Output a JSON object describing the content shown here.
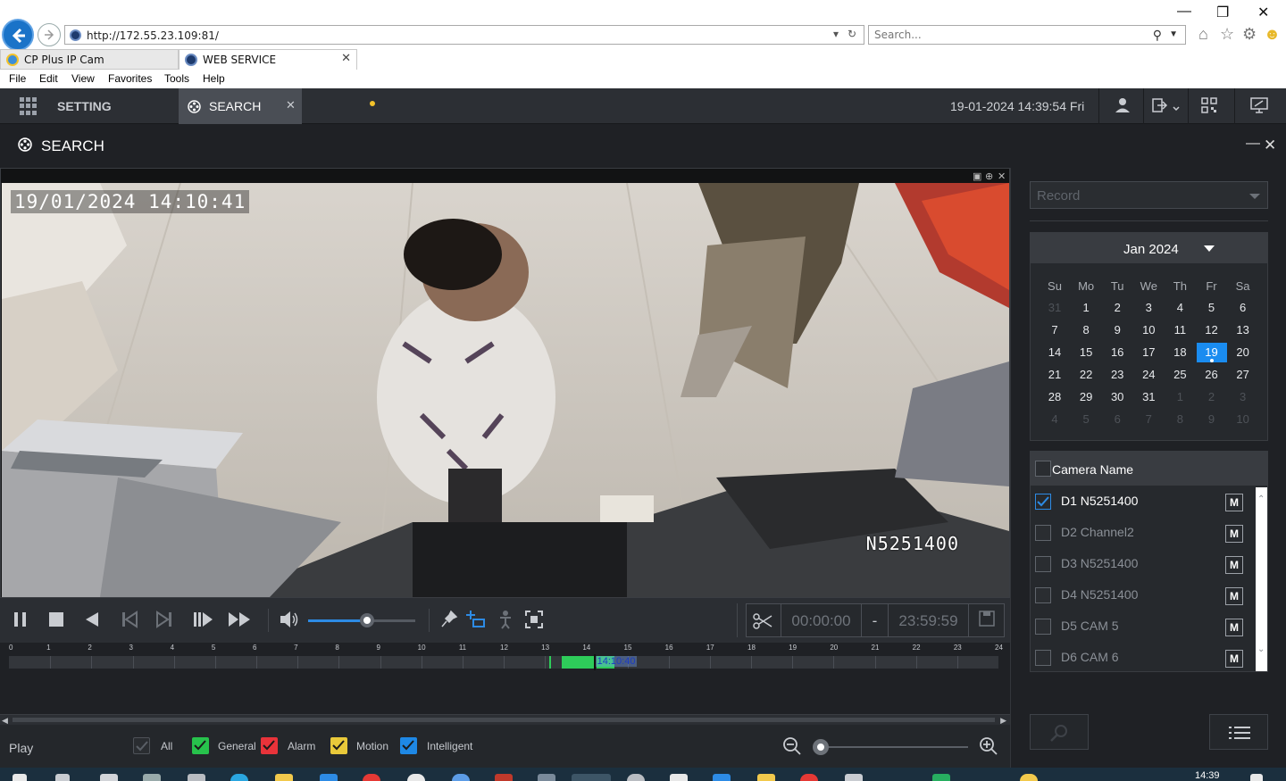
{
  "browser": {
    "url": "http://172.55.23.109:81/",
    "search_placeholder": "Search...",
    "tabs": [
      {
        "label": "CP Plus IP Cam",
        "active": false
      },
      {
        "label": "WEB SERVICE",
        "active": true
      }
    ],
    "menu": [
      "File",
      "Edit",
      "View",
      "Favorites",
      "Tools",
      "Help"
    ]
  },
  "app": {
    "nav_tabs": [
      "SETTING",
      "SEARCH"
    ],
    "clock": "19-01-2024 14:39:54 Fri",
    "page_title": "SEARCH"
  },
  "video": {
    "osd_timestamp": "19/01/2024 14:10:41",
    "osd_camera": "N5251400"
  },
  "controls": {
    "volume_level": 0.55,
    "clip_start": "00:00:00",
    "clip_sep": "-",
    "clip_end": "23:59:59"
  },
  "timeline": {
    "hours": [
      "0",
      "1",
      "2",
      "3",
      "4",
      "5",
      "6",
      "7",
      "8",
      "9",
      "10",
      "11",
      "12",
      "13",
      "14",
      "15",
      "16",
      "17",
      "18",
      "19",
      "20",
      "21",
      "22",
      "23",
      "24"
    ],
    "recordings": [
      [
        13.1,
        13.15
      ],
      [
        13.4,
        14.2
      ],
      [
        14.25,
        14.68
      ]
    ],
    "cursor_hour": 14.18,
    "cursor_label": "14:10:40"
  },
  "bottom": {
    "mode": "Play",
    "filters": [
      {
        "label": "All",
        "checked": true,
        "color": "#2a2d31"
      },
      {
        "label": "General",
        "checked": true,
        "color": "#27c24c"
      },
      {
        "label": "Alarm",
        "checked": true,
        "color": "#e8333a"
      },
      {
        "label": "Motion",
        "checked": true,
        "color": "#e9c93a"
      },
      {
        "label": "Intelligent",
        "checked": true,
        "color": "#1e88e5"
      }
    ]
  },
  "right_panel": {
    "record_type": "Record",
    "calendar": {
      "month_label": "Jan 2024",
      "dow": [
        "Su",
        "Mo",
        "Tu",
        "We",
        "Th",
        "Fr",
        "Sa"
      ],
      "weeks": [
        [
          "31",
          "1",
          "2",
          "3",
          "4",
          "5",
          "6"
        ],
        [
          "7",
          "8",
          "9",
          "10",
          "11",
          "12",
          "13"
        ],
        [
          "14",
          "15",
          "16",
          "17",
          "18",
          "19",
          "20"
        ],
        [
          "21",
          "22",
          "23",
          "24",
          "25",
          "26",
          "27"
        ],
        [
          "28",
          "29",
          "30",
          "31",
          "1",
          "2",
          "3"
        ],
        [
          "4",
          "5",
          "6",
          "7",
          "8",
          "9",
          "10"
        ]
      ],
      "selected_day": "19"
    },
    "camera_header": "Camera Name",
    "cameras": [
      {
        "name": "D1 N5251400",
        "checked": true
      },
      {
        "name": "D2 Channel2",
        "checked": false
      },
      {
        "name": "D3 N5251400",
        "checked": false
      },
      {
        "name": "D4 N5251400",
        "checked": false
      },
      {
        "name": "D5 CAM 5",
        "checked": false
      },
      {
        "name": "D6 CAM 6",
        "checked": false
      }
    ],
    "m_label": "M"
  },
  "taskbar": {
    "time": "14:39"
  },
  "colors": {
    "accent": "#1a8cf0",
    "background": "#1f2125",
    "recording": "#2ecc5a"
  }
}
